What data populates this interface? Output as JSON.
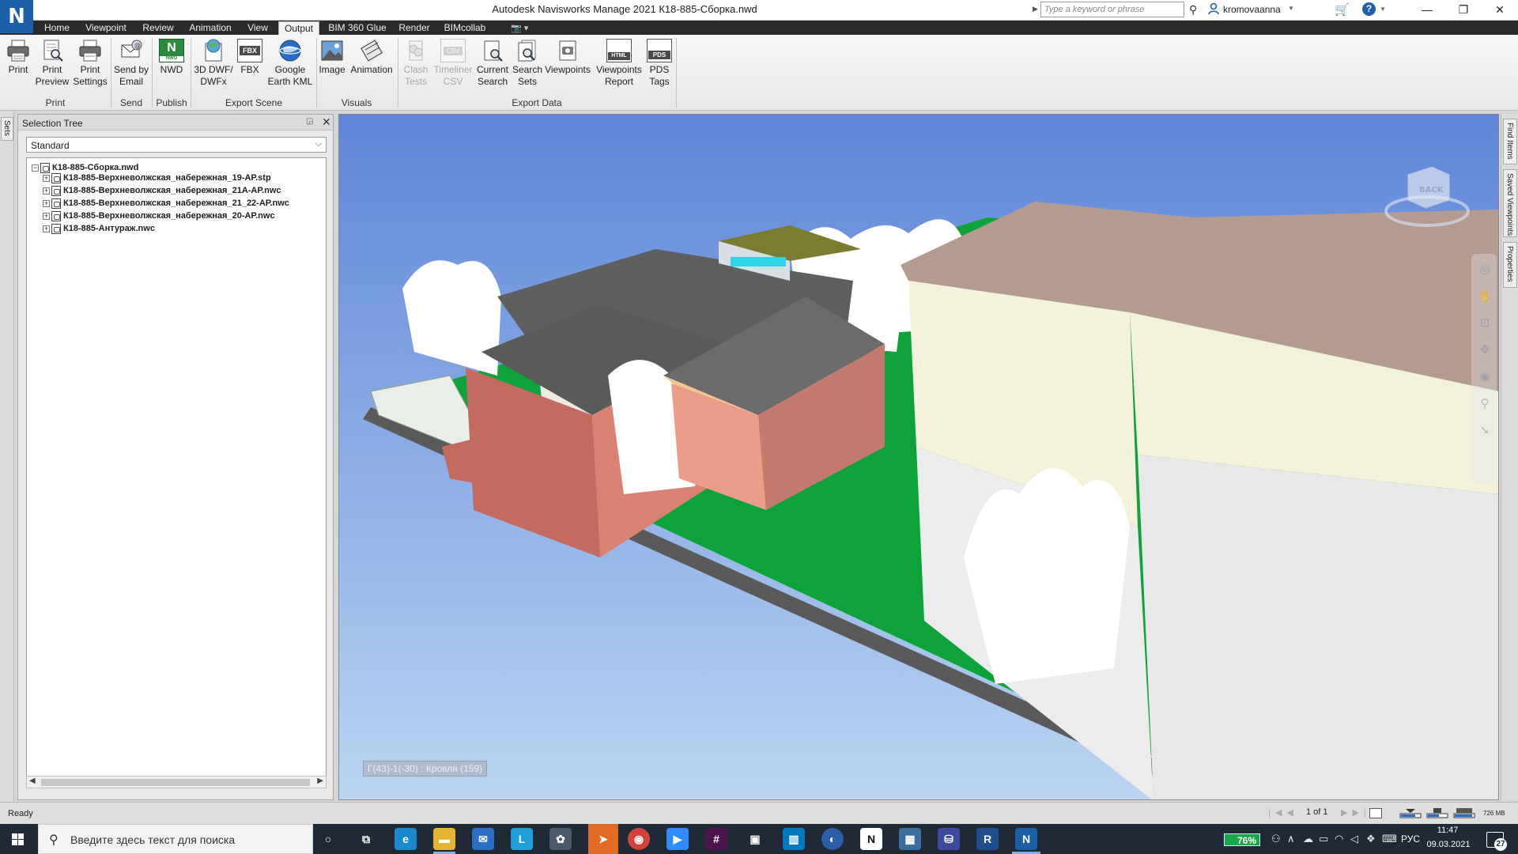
{
  "window": {
    "logo_letter": "N",
    "title": "Autodesk Navisworks Manage 2021    К18-885-Сборка.nwd",
    "search_placeholder": "Type a keyword or phrase",
    "user": "kromovaanna",
    "controls": [
      "—",
      "❐",
      "✕"
    ]
  },
  "tabs": [
    {
      "label": "Home",
      "active": false
    },
    {
      "label": "Viewpoint",
      "active": false
    },
    {
      "label": "Review",
      "active": false
    },
    {
      "label": "Animation",
      "active": false
    },
    {
      "label": "View",
      "active": false
    },
    {
      "label": "Output",
      "active": true
    },
    {
      "label": "BIM 360 Glue",
      "active": false
    },
    {
      "label": "Render",
      "active": false
    },
    {
      "label": "BIMcollab",
      "active": false
    }
  ],
  "ribbon": {
    "buttons": [
      {
        "line1": "Print",
        "line2": "",
        "icon": "printer-icon",
        "enabled": true
      },
      {
        "line1": "Print",
        "line2": "Preview",
        "icon": "print-preview-icon",
        "enabled": true
      },
      {
        "line1": "Print",
        "line2": "Settings",
        "icon": "print-settings-icon",
        "enabled": true
      },
      {
        "line1": "Send by",
        "line2": "Email",
        "icon": "email-icon",
        "enabled": true
      },
      {
        "line1": "NWD",
        "line2": "",
        "icon": "nwd-icon",
        "enabled": true
      },
      {
        "line1": "3D DWF/",
        "line2": "DWFx",
        "icon": "dwf-icon",
        "enabled": true
      },
      {
        "line1": "FBX",
        "line2": "",
        "icon": "fbx-icon",
        "enabled": true
      },
      {
        "line1": "Google",
        "line2": "Earth KML",
        "icon": "globe-icon",
        "enabled": true
      },
      {
        "line1": "Image",
        "line2": "",
        "icon": "image-icon",
        "enabled": true
      },
      {
        "line1": "Animation",
        "line2": "",
        "icon": "animation-icon",
        "enabled": true
      },
      {
        "line1": "Clash",
        "line2": "Tests",
        "icon": "clash-tests-icon",
        "enabled": false
      },
      {
        "line1": "Timeliner",
        "line2": "CSV",
        "icon": "csv-icon",
        "enabled": false
      },
      {
        "line1": "Current",
        "line2": "Search",
        "icon": "current-search-icon",
        "enabled": true
      },
      {
        "line1": "Search",
        "line2": "Sets",
        "icon": "search-sets-icon",
        "enabled": true
      },
      {
        "line1": "Viewpoints",
        "line2": "",
        "icon": "viewpoints-icon",
        "enabled": true
      },
      {
        "line1": "Viewpoints",
        "line2": "Report",
        "icon": "html-report-icon",
        "enabled": true
      },
      {
        "line1": "PDS",
        "line2": "Tags",
        "icon": "pds-tags-icon",
        "enabled": true
      }
    ],
    "nwd_badge": "N",
    "nwd_sub": "NWD",
    "fbx_badge": "FBX",
    "csv_badge": "CSV",
    "html_badge": "HTML",
    "pds_badge": "PDS",
    "groups": [
      {
        "label": "Print"
      },
      {
        "label": "Send"
      },
      {
        "label": "Publish"
      },
      {
        "label": "Export Scene"
      },
      {
        "label": "Visuals"
      },
      {
        "label": "Export Data"
      }
    ]
  },
  "left_dock": {
    "tab": "Sets"
  },
  "selection_tree": {
    "title": "Selection Tree",
    "dropdown": "Standard",
    "root": "К18-885-Сборка.nwd",
    "children": [
      "К18-885-Верхневолжская_набережная_19-АР.stp",
      "К18-885-Верхневолжская_набережная_21А-АР.nwc",
      "К18-885-Верхневолжская_набережная_21_22-АР.nwc",
      "К18-885-Верхневолжская_набережная_20-АР.nwc",
      "К18-885-Антураж.nwc"
    ]
  },
  "viewport": {
    "viewcube_face": "BACK",
    "tooltip": "Г(43)-1(-30) : Кровля (159)"
  },
  "right_dock": {
    "tabs": [
      "Find Items",
      "Saved Viewpoints",
      "Properties"
    ]
  },
  "status": {
    "text": "Ready",
    "page": "1 of 1",
    "memory": "726 MB"
  },
  "taskbar": {
    "search_placeholder": "Введите здесь текст для поиска",
    "apps": [
      {
        "name": "Cortana",
        "color": "#1f2a36",
        "glyph": "○"
      },
      {
        "name": "Task View",
        "color": "#1f2a36",
        "glyph": "⧉"
      },
      {
        "name": "Edge",
        "color": "#1a8ad0",
        "glyph": "e"
      },
      {
        "name": "File Explorer",
        "color": "#e7b332",
        "glyph": "▬"
      },
      {
        "name": "Mail",
        "color": "#2a6fc4",
        "glyph": "✉",
        "badge": "3"
      },
      {
        "name": "Lightroom",
        "color": "#1e9fd8",
        "glyph": "L"
      },
      {
        "name": "Viewer",
        "color": "#4b5a6a",
        "glyph": "✿"
      },
      {
        "name": "Telegram",
        "color": "#e36a25",
        "glyph": "➤"
      },
      {
        "name": "Chrome",
        "color": "#d54238",
        "glyph": "◉"
      },
      {
        "name": "Zoom",
        "color": "#2d8cff",
        "glyph": "▶"
      },
      {
        "name": "Slack",
        "color": "#4a154b",
        "glyph": "#"
      },
      {
        "name": "Store",
        "color": "#1f2a36",
        "glyph": "▣"
      },
      {
        "name": "Trello",
        "color": "#0079bf",
        "glyph": "▥"
      },
      {
        "name": "Navigator",
        "color": "#2b5ea8",
        "glyph": "◐"
      },
      {
        "name": "Notion",
        "color": "#ffffff",
        "glyph": "N"
      },
      {
        "name": "ReCap",
        "color": "#3a6e9f",
        "glyph": "▦"
      },
      {
        "name": "Network",
        "color": "#3a4a9c",
        "glyph": "⛁"
      },
      {
        "name": "Revit",
        "color": "#1f4e8f",
        "glyph": "R"
      },
      {
        "name": "Navisworks",
        "color": "#1b5fa8",
        "glyph": "N"
      }
    ],
    "battery": "76%",
    "lang": "РУС",
    "time": "11:47",
    "date": "09.03.2021",
    "notifications": "27"
  }
}
